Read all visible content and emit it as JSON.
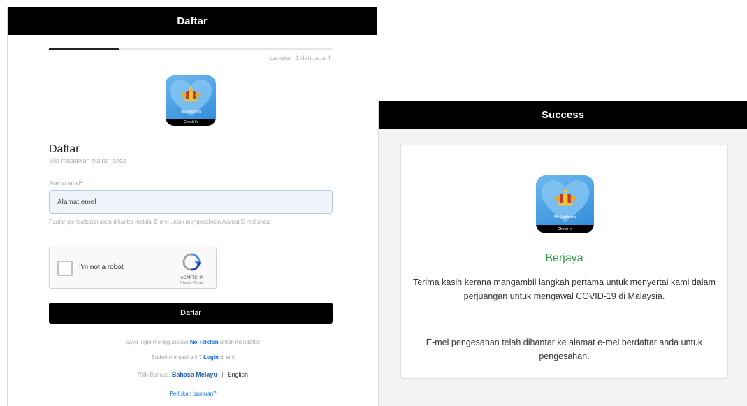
{
  "register": {
    "header_title": "Daftar",
    "progress": 0.25,
    "step_text": "Langkah 1 daripada 4",
    "app_logo": {
      "name": "mysejahtera-app-icon",
      "brand_text": "MySejahtera",
      "strip_text": "Check In"
    },
    "form_title": "Daftar",
    "form_subtitle": "Sila masukkan butiran anda",
    "email_label": "Alamat emel",
    "email_required_mark": "*",
    "email_placeholder": "Alamat emel",
    "email_help": "Pautan pendaftaran akan dihantar melalui E-mel untuk mengesahkan Alamat E-mel anda!",
    "captcha": {
      "label": "I'm not a robot",
      "brand": "reCAPTCHA",
      "links": "Privacy - Terms"
    },
    "submit_label": "Daftar",
    "phone_line": {
      "prefix": "Saya ingin menggunakan",
      "link": "No Telefon",
      "suffix": "untuk mendaftar"
    },
    "login_line": {
      "prefix": "Sudah menjadi ahli?",
      "link": "Login",
      "suffix": "di sini"
    },
    "lang_line": {
      "prefix": "Pilih Bahasa:",
      "selected": "Bahasa Melayu",
      "separator": "|",
      "alternative": "English"
    },
    "help_link": "Perlukan bantuan?"
  },
  "success": {
    "header_title": "Success",
    "app_logo": {
      "name": "mysejahtera-app-icon",
      "brand_text": "MySejahtera",
      "strip_text": "Check In"
    },
    "title": "Berjaya",
    "message": "Terima kasih kerana mangambil langkah pertama untuk menyertai kami dalam perjuangan untuk mengawal COVID-19 di Malaysia.",
    "message2": "E-mel pengesahan telah dihantar ke alamat e-mel berdaftar anda untuk pengesahan."
  },
  "colors": {
    "header_bg": "#000000",
    "link_blue": "#1a73e8",
    "success_green": "#2e9e3e",
    "required_red": "#e02020",
    "logo_blue": "#3a98e3"
  }
}
